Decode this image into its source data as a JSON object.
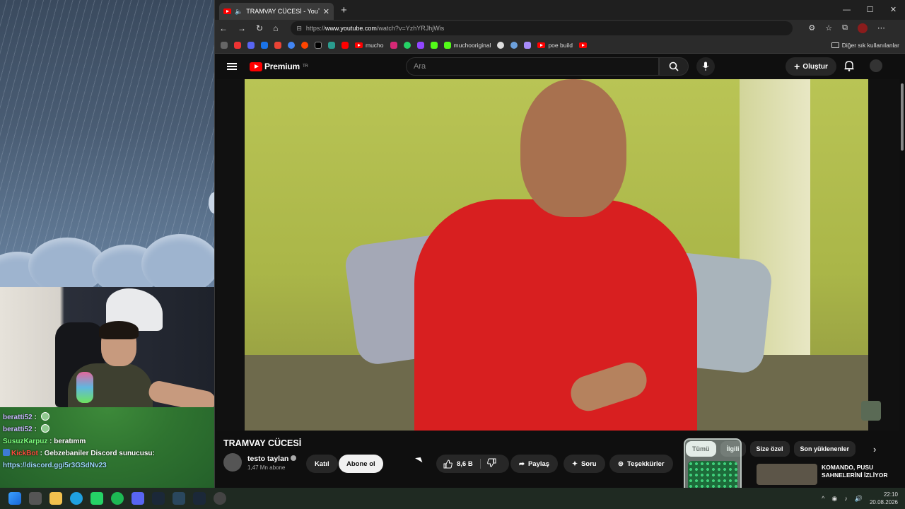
{
  "chat": [
    {
      "user": "beratti52",
      "text": ""
    },
    {
      "user": "beratti52",
      "text": ""
    },
    {
      "user": "SusuzKarpuz",
      "text": " : beratımm"
    },
    {
      "user": "KickBot",
      "text": " : Gebzebaniler Discord sunucusu:"
    },
    {
      "user": "",
      "text": "https://discord.gg/5r3GSdNv23"
    }
  ],
  "browser": {
    "tab_title": "TRAMVAY CÜCESİ - YouTube",
    "url_prefix": "https://",
    "url_host": "www.youtube.com",
    "url_path": "/watch?v=YzhYRJhjWis",
    "bookmarks": [
      "mucho",
      "muchooriginal",
      "poe build"
    ],
    "other_bookmarks": "Diğer sık kullanılanlar"
  },
  "youtube": {
    "logo": "Premium",
    "logo_region": "TR",
    "search_placeholder": "Ara",
    "create": "Oluştur",
    "video_title": "TRAMVAY CÜCESİ",
    "channel": "testo taylan",
    "subscribers": "1,47 Mn abone",
    "join": "Katıl",
    "subscribe": "Abone ol",
    "likes": "8,6 B",
    "share": "Paylaş",
    "ask": "Soru",
    "thanks": "Teşekkürler",
    "chips": [
      "Tümü",
      "İlgili",
      "Size özel",
      "Son yüklenenler"
    ],
    "rec_title": "KOMANDO, PUSU SAHNELERİNİ İZLİYOR"
  },
  "taskbar": {
    "time": "22:10",
    "date": "20.08.2026"
  },
  "colors": {
    "accent": "#ff0000",
    "chip_active": "#f1f1f1"
  }
}
